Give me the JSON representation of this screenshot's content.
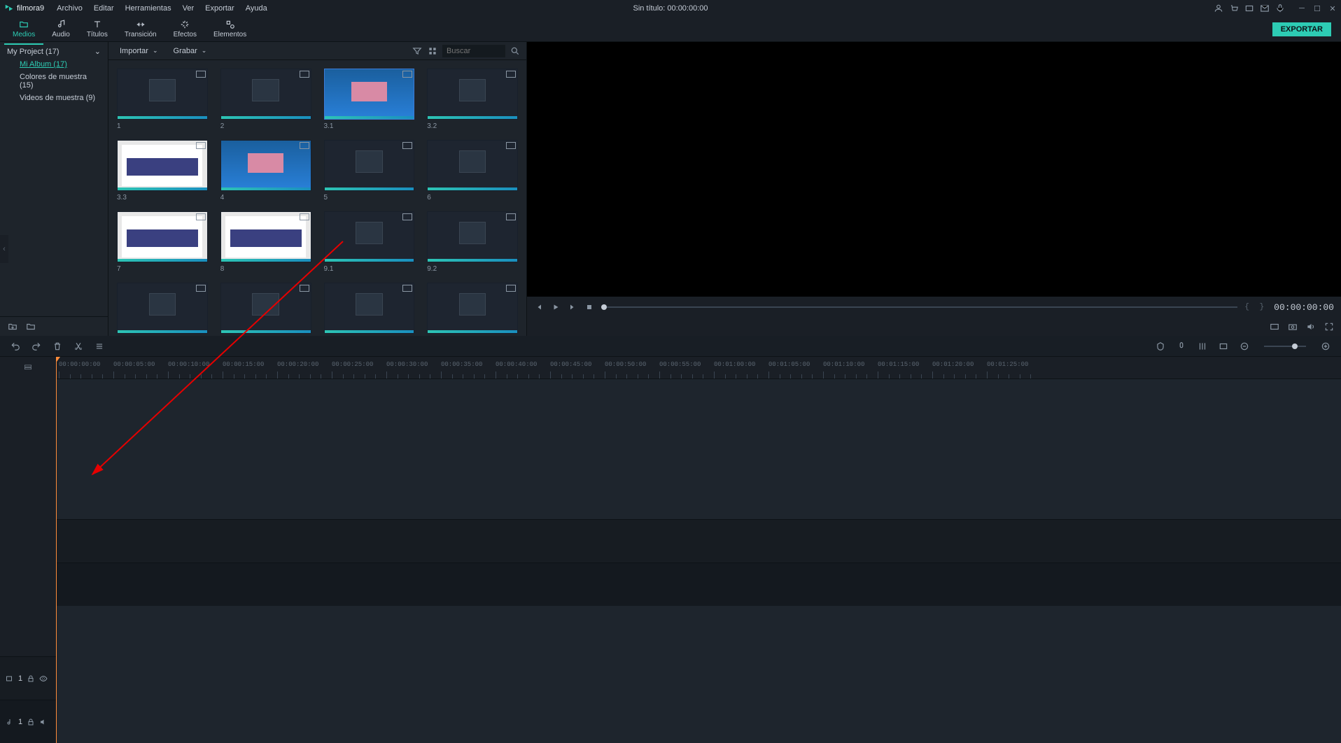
{
  "app": {
    "name": "filmora",
    "version": "9"
  },
  "menu": [
    "Archivo",
    "Editar",
    "Herramientas",
    "Ver",
    "Exportar",
    "Ayuda"
  ],
  "title": {
    "project": "Sin título:",
    "time": "00:00:00:00"
  },
  "tabs": [
    {
      "label": "Medios",
      "icon": "folder"
    },
    {
      "label": "Audio",
      "icon": "note"
    },
    {
      "label": "Títulos",
      "icon": "text"
    },
    {
      "label": "Transición",
      "icon": "swap"
    },
    {
      "label": "Efectos",
      "icon": "sparkle"
    },
    {
      "label": "Elementos",
      "icon": "shapes"
    }
  ],
  "export_label": "EXPORTAR",
  "sidebar": {
    "project": "My Project (17)",
    "items": [
      {
        "label": "Mi Album (17)",
        "active": true
      },
      {
        "label": "Colores de muestra (15)"
      },
      {
        "label": "Videos de muestra (9)"
      }
    ]
  },
  "media_toolbar": {
    "import": "Importar",
    "record": "Grabar",
    "search_placeholder": "Buscar"
  },
  "clips": [
    {
      "label": "1",
      "style": "dark"
    },
    {
      "label": "2",
      "style": "dark"
    },
    {
      "label": "3.1",
      "style": "desktop",
      "selected": true
    },
    {
      "label": "3.2",
      "style": "dark"
    },
    {
      "label": "3.3",
      "style": "web"
    },
    {
      "label": "4",
      "style": "desktop"
    },
    {
      "label": "5",
      "style": "dark"
    },
    {
      "label": "6",
      "style": "dark"
    },
    {
      "label": "7",
      "style": "web"
    },
    {
      "label": "8",
      "style": "web"
    },
    {
      "label": "9.1",
      "style": "dark"
    },
    {
      "label": "9.2",
      "style": "dark"
    },
    {
      "label": "",
      "style": "dark"
    },
    {
      "label": "",
      "style": "dark"
    },
    {
      "label": "",
      "style": "dark"
    },
    {
      "label": "",
      "style": "dark"
    }
  ],
  "preview": {
    "time": "00:00:00:00"
  },
  "timeline": {
    "marks": [
      "00:00:00:00",
      "00:00:05:00",
      "00:00:10:00",
      "00:00:15:00",
      "00:00:20:00",
      "00:00:25:00",
      "00:00:30:00",
      "00:00:35:00",
      "00:00:40:00",
      "00:00:45:00",
      "00:00:50:00",
      "00:00:55:00",
      "00:01:00:00",
      "00:01:05:00",
      "00:01:10:00",
      "00:01:15:00",
      "00:01:20:00",
      "00:01:25:00"
    ],
    "video_track": "1",
    "audio_track": "1"
  }
}
